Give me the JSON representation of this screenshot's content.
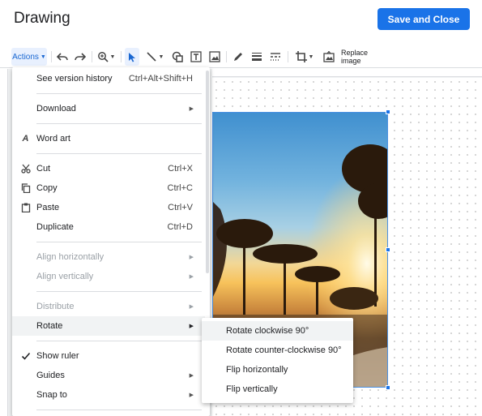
{
  "header": {
    "title": "Drawing",
    "save_close_label": "Save and Close"
  },
  "toolbar": {
    "actions_label": "Actions",
    "replace_image_label": "Replace image"
  },
  "menu": {
    "see_version_history": {
      "label": "See version history",
      "shortcut": "Ctrl+Alt+Shift+H"
    },
    "download": {
      "label": "Download"
    },
    "word_art": {
      "label": "Word art"
    },
    "cut": {
      "label": "Cut",
      "shortcut": "Ctrl+X"
    },
    "copy": {
      "label": "Copy",
      "shortcut": "Ctrl+C"
    },
    "paste": {
      "label": "Paste",
      "shortcut": "Ctrl+V"
    },
    "duplicate": {
      "label": "Duplicate",
      "shortcut": "Ctrl+D"
    },
    "align_horizontally": {
      "label": "Align horizontally"
    },
    "align_vertically": {
      "label": "Align vertically"
    },
    "distribute": {
      "label": "Distribute"
    },
    "rotate": {
      "label": "Rotate"
    },
    "show_ruler": {
      "label": "Show ruler"
    },
    "guides": {
      "label": "Guides"
    },
    "snap_to": {
      "label": "Snap to"
    }
  },
  "submenu": {
    "rotate_cw": "Rotate clockwise 90°",
    "rotate_ccw": "Rotate counter-clockwise 90°",
    "flip_h": "Flip horizontally",
    "flip_v": "Flip vertically"
  },
  "colors": {
    "accent": "#1a73e8",
    "menu_highlight": "#f1f3f4",
    "disabled_text": "#9aa0a6"
  }
}
